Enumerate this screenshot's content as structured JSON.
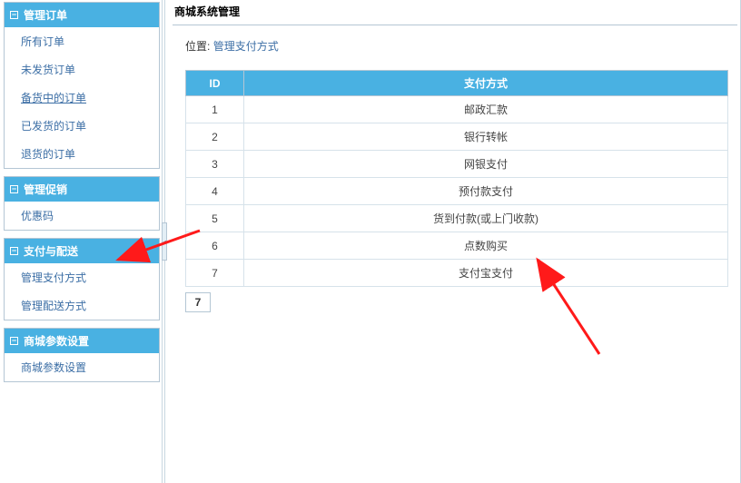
{
  "sidebar": {
    "panels": [
      {
        "title": "管理订单",
        "items": [
          {
            "label": "所有订单",
            "active": false
          },
          {
            "label": "未发货订单",
            "active": false
          },
          {
            "label": "备货中的订单",
            "active": true
          },
          {
            "label": "已发货的订单",
            "active": false
          },
          {
            "label": "退货的订单",
            "active": false
          }
        ]
      },
      {
        "title": "管理促销",
        "items": [
          {
            "label": "优惠码",
            "active": false
          }
        ]
      },
      {
        "title": "支付与配送",
        "items": [
          {
            "label": "管理支付方式",
            "active": false
          },
          {
            "label": "管理配送方式",
            "active": false
          }
        ]
      },
      {
        "title": "商城参数设置",
        "items": [
          {
            "label": "商城参数设置",
            "active": false
          }
        ]
      }
    ]
  },
  "main": {
    "title": "商城系统管理",
    "breadcrumb_label": "位置",
    "breadcrumb_sep": ": ",
    "breadcrumb_link": "管理支付方式",
    "table": {
      "headers": {
        "id": "ID",
        "method": "支付方式"
      },
      "rows": [
        {
          "id": "1",
          "method": "邮政汇款"
        },
        {
          "id": "2",
          "method": "银行转帐"
        },
        {
          "id": "3",
          "method": "网银支付"
        },
        {
          "id": "4",
          "method": "预付款支付"
        },
        {
          "id": "5",
          "method": "货到付款(或上门收款)"
        },
        {
          "id": "6",
          "method": "点数购买"
        },
        {
          "id": "7",
          "method": "支付宝支付"
        }
      ]
    },
    "pager": {
      "current": "7"
    }
  }
}
